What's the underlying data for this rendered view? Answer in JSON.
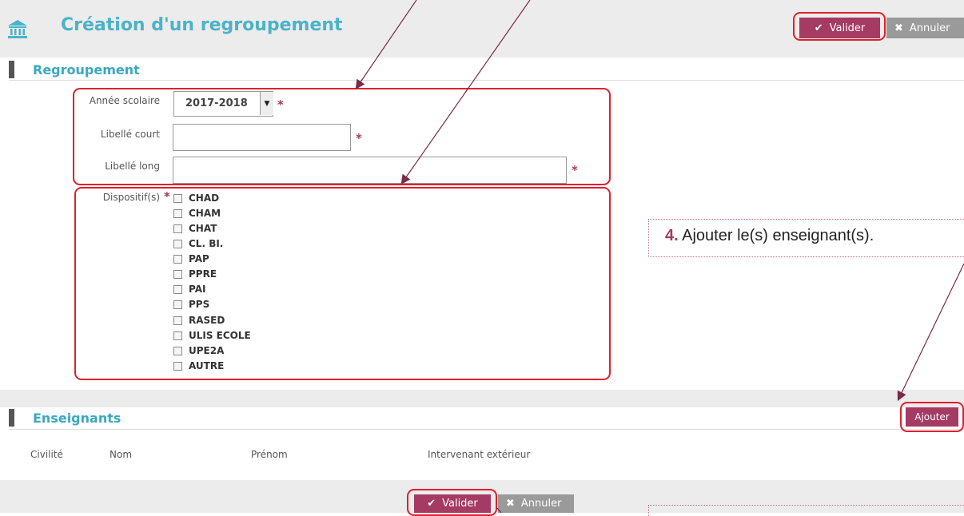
{
  "header": {
    "title": "Création d'un regroupement",
    "valider_label": "Valider",
    "annuler_label": "Annuler"
  },
  "regroupement": {
    "section_title": "Regroupement",
    "annee_label": "Année scolaire",
    "annee_value": "2017-2018",
    "libelle_court_label": "Libellé court",
    "libelle_court_value": "",
    "libelle_long_label": "Libellé long",
    "libelle_long_value": "",
    "dispositifs_label": "Dispositif(s)",
    "required_mark": "*",
    "dispositifs": [
      "CHAD",
      "CHAM",
      "CHAT",
      "CL. BI.",
      "PAP",
      "PPRE",
      "PAI",
      "PPS",
      "RASED",
      "ULIS ECOLE",
      "UPE2A",
      "AUTRE"
    ]
  },
  "callout": {
    "number": "4.",
    "text": "Ajouter le(s) enseignant(s)."
  },
  "enseignants": {
    "section_title": "Enseignants",
    "ajouter_label": "Ajouter",
    "columns": [
      "Civilité",
      "Nom",
      "Prénom",
      "Intervenant extérieur"
    ]
  },
  "footer": {
    "valider_label": "Valider",
    "annuler_label": "Annuler"
  },
  "colors": {
    "accent": "#a53a63",
    "title_blue": "#4bb3c9",
    "annotation_red": "#e0202c",
    "arrow": "#7a2a4a"
  }
}
